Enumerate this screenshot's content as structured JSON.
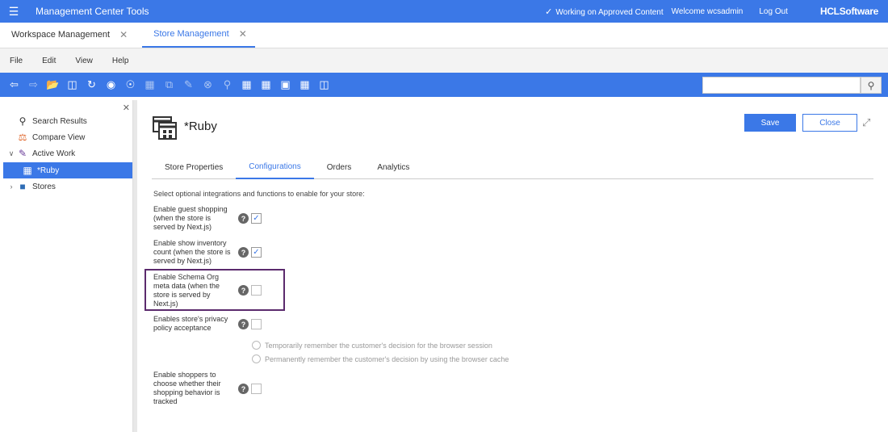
{
  "topbar": {
    "title": "Management Center Tools",
    "status": "Working on Approved Content",
    "welcome": "Welcome wcsadmin",
    "logout": "Log Out",
    "brand": "HCLSoftware"
  },
  "workspace_tabs": [
    {
      "label": "Workspace Management",
      "active": false
    },
    {
      "label": "Store Management",
      "active": true
    }
  ],
  "menu": [
    "File",
    "Edit",
    "View",
    "Help"
  ],
  "toolbar": {
    "icons": [
      "back-icon",
      "forward-icon",
      "open-folder-icon",
      "save-icon",
      "refresh-icon",
      "stop-icon",
      "globe-icon",
      "columns-icon",
      "copy-icon",
      "paste-icon",
      "cancel-icon",
      "find-icon",
      "store-calendar-icon",
      "store-edit-icon",
      "store-preview-icon",
      "grid-icon",
      "split-icon"
    ],
    "search_placeholder": ""
  },
  "navigator": {
    "items": [
      {
        "label": "Search Results",
        "icon": "search-icon"
      },
      {
        "label": "Compare View",
        "icon": "scale-icon"
      },
      {
        "label": "Active Work",
        "icon": "pencil-icon"
      },
      {
        "label": "*Ruby",
        "icon": "store-icon",
        "selected": true
      },
      {
        "label": "Stores",
        "icon": "folder-icon"
      }
    ]
  },
  "editor": {
    "title": "*Ruby",
    "save_label": "Save",
    "close_label": "Close",
    "tabs": [
      {
        "label": "Store Properties",
        "active": false
      },
      {
        "label": "Configurations",
        "active": true
      },
      {
        "label": "Orders",
        "active": false
      },
      {
        "label": "Analytics",
        "active": false
      }
    ],
    "intro": "Select optional integrations and functions to enable for your store:",
    "options": [
      {
        "line1": "Enable guest shopping",
        "line2": "(when the store is",
        "line3": "served by Next.js)",
        "line4": "",
        "checked": true
      },
      {
        "line1": "Enable show inventory",
        "line2": "count (when the store is",
        "line3": "served by Next.js)",
        "line4": "",
        "checked": true
      },
      {
        "line1": "Enable Schema Org",
        "line2": "meta data (when the",
        "line3": "store is served by",
        "line4": "Next.js)",
        "checked": false
      },
      {
        "line1": "Enables store's privacy",
        "line2": "policy acceptance",
        "line3": "",
        "line4": "",
        "checked": false
      },
      {
        "line1": "Enable shoppers to",
        "line2": "choose whether their",
        "line3": "shopping behavior is",
        "line4": "tracked",
        "checked": false
      }
    ],
    "radio_options": [
      "Temporarily remember the customer's decision for the browser session",
      "Permanently remember the customer's decision by using the browser cache"
    ]
  },
  "colors": {
    "accent": "#3b78e7",
    "highlight": "#5b2a6d"
  }
}
